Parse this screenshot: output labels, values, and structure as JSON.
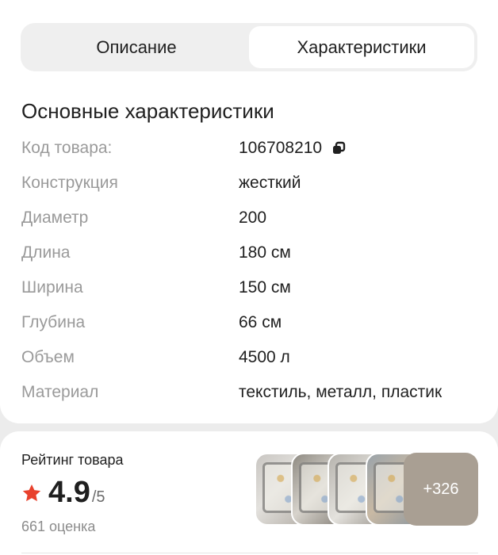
{
  "tabs": [
    {
      "label": "Описание",
      "active": false
    },
    {
      "label": "Характеристики",
      "active": true
    }
  ],
  "specs": {
    "title": "Основные характеристики",
    "rows": [
      {
        "key": "Код товара:",
        "value": "106708210",
        "copy_icon": "copy-icon"
      },
      {
        "key": "Конструкция",
        "value": "жесткий"
      },
      {
        "key": "Диаметр",
        "value": "200"
      },
      {
        "key": "Длина",
        "value": "180 см"
      },
      {
        "key": "Ширина",
        "value": "150 см"
      },
      {
        "key": "Глубина",
        "value": "66 см"
      },
      {
        "key": "Объем",
        "value": "4500 л"
      },
      {
        "key": "Материал",
        "value": "текстиль, металл, пластик"
      }
    ]
  },
  "rating": {
    "title": "Рейтинг товара",
    "value": "4.9",
    "max": "/5",
    "count": "661 оценка",
    "star_color": "#e8412c",
    "icon": "star-icon"
  },
  "gallery": {
    "more_label": "+326"
  }
}
